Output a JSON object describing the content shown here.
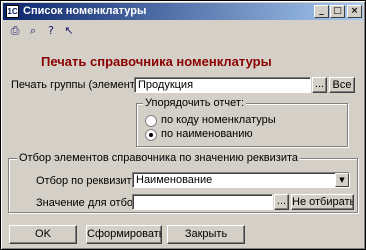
{
  "window": {
    "title": "Список номенклатуры"
  },
  "toolbar": {
    "icons": [
      "print-icon",
      "print-preview-icon",
      "help-icon",
      "context-help-icon"
    ]
  },
  "heading": "Печать справочника номенклатуры",
  "print_group": {
    "label": "Печать группы (элемента):",
    "value": "Продукция",
    "choose_label": "...",
    "all_label": "Все"
  },
  "sort": {
    "title": "Упорядочить отчет:",
    "options": [
      "по коду номенклатуры",
      "по наименованию"
    ],
    "selected": 1
  },
  "filter": {
    "title": "Отбор элементов справочника по значению реквизита",
    "attribute_label": "Отбор по реквизиту:",
    "attribute_value": "Наименование",
    "value_label": "Значение для отбора:",
    "value": "",
    "choose_label": "...",
    "no_filter_label": "Не отбирать"
  },
  "buttons": {
    "ok": "OK",
    "build": "Сформировать",
    "close": "Закрыть"
  }
}
